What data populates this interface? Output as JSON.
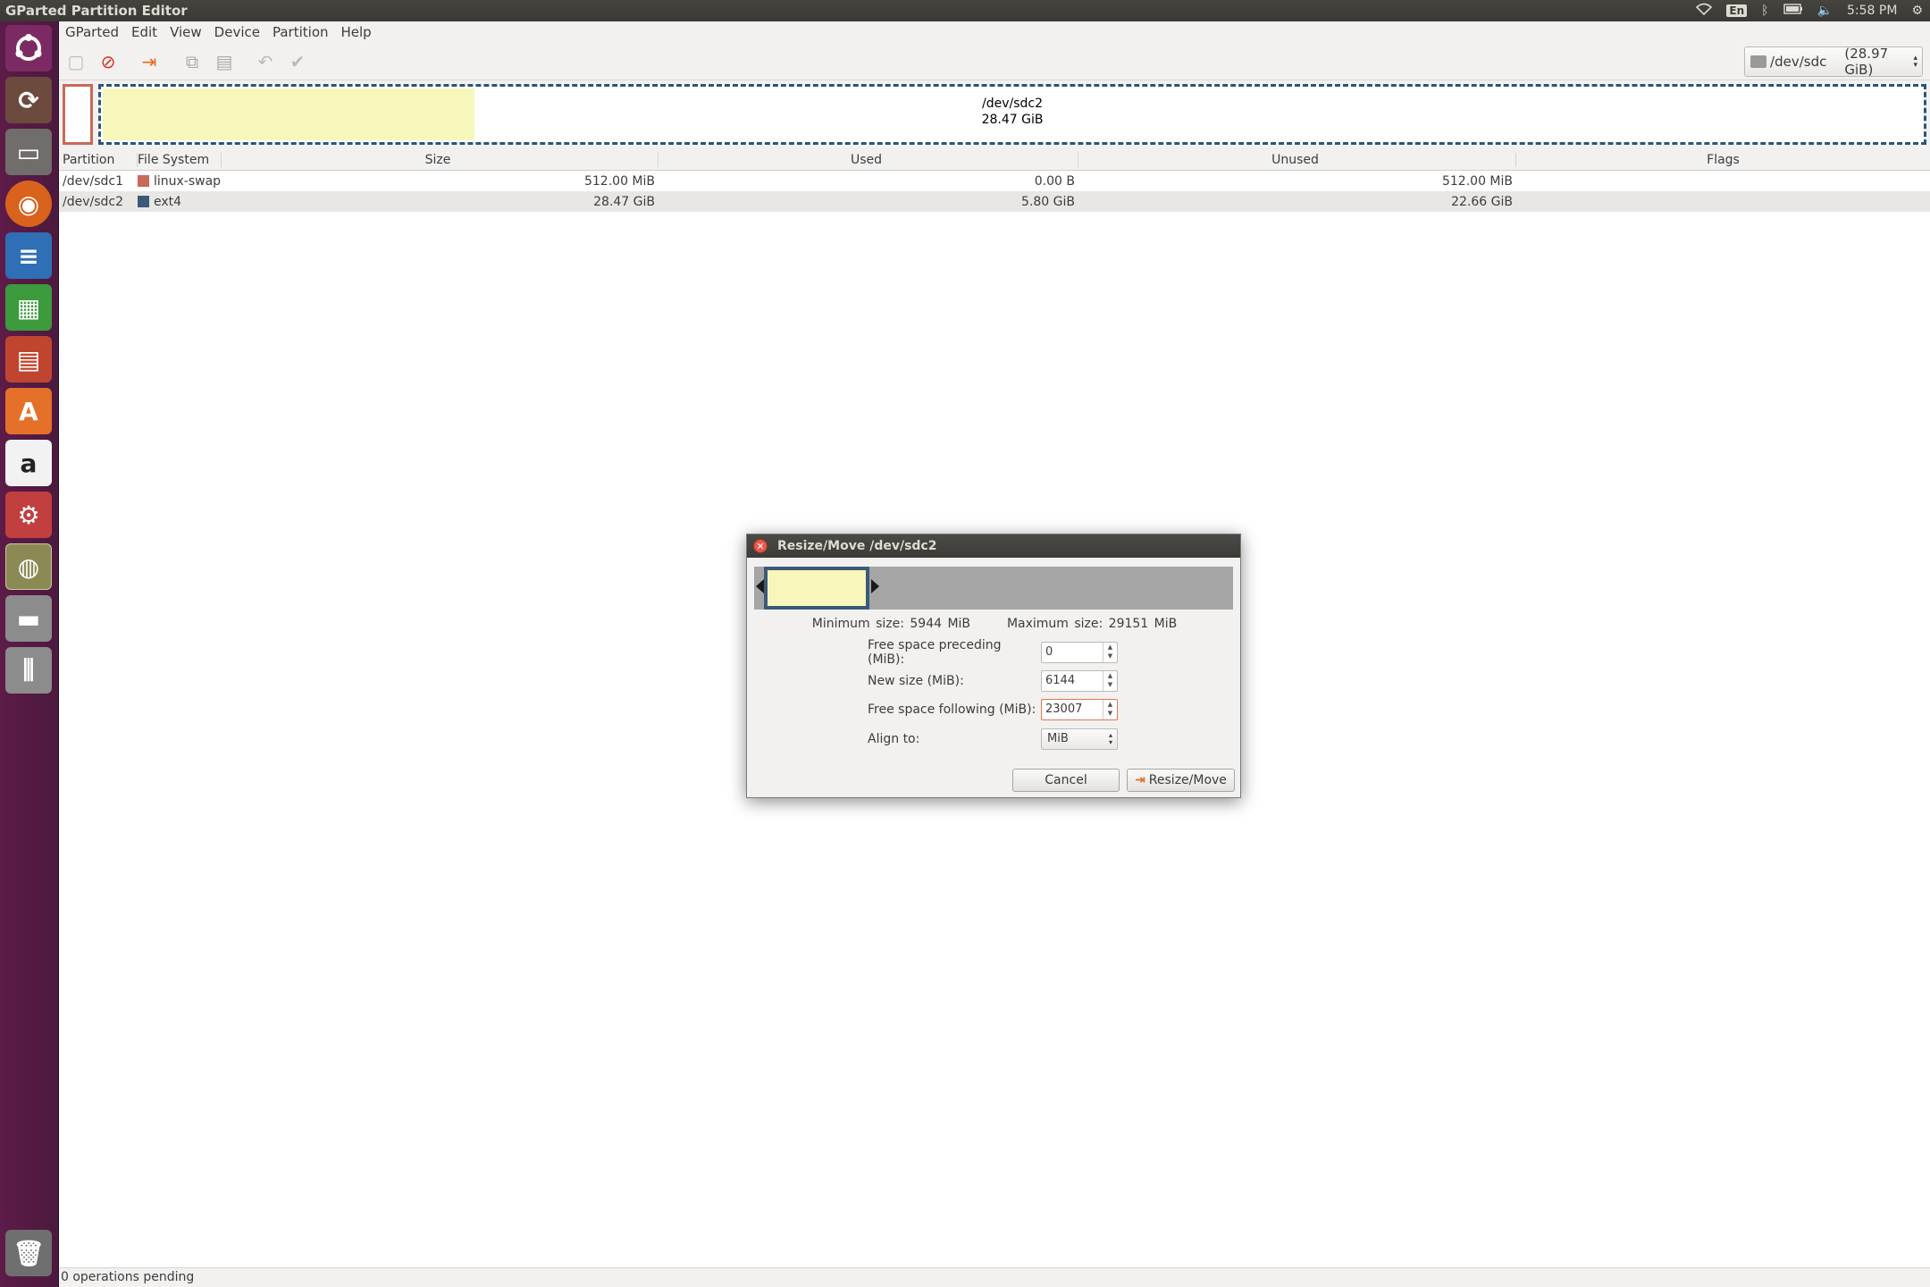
{
  "window": {
    "title": "GParted Partition Editor"
  },
  "menubar": [
    "GParted",
    "Edit",
    "View",
    "Device",
    "Partition",
    "Help"
  ],
  "indicators": {
    "keyboard": "En",
    "time": "5:58 PM"
  },
  "device_selector": {
    "device": "/dev/sdc",
    "size": "(28.97 GiB)"
  },
  "disk_map": {
    "partition_name": "/dev/sdc2",
    "partition_size": "28.47 GiB",
    "used_fraction": 0.204
  },
  "partition_table": {
    "headers": [
      "Partition",
      "File System",
      "Size",
      "Used",
      "Unused",
      "Flags"
    ],
    "rows": [
      {
        "partition": "/dev/sdc1",
        "fs": "linux-swap",
        "fs_color": "#c86959",
        "size": "512.00 MiB",
        "used": "0.00 B",
        "unused": "512.00 MiB",
        "flags": ""
      },
      {
        "partition": "/dev/sdc2",
        "fs": "ext4",
        "fs_color": "#3b5a7a",
        "size": "28.47 GiB",
        "used": "5.80 GiB",
        "unused": "22.66 GiB",
        "flags": ""
      }
    ]
  },
  "status": "0 operations pending",
  "dialog": {
    "title": "Resize/Move /dev/sdc2",
    "min_size": "Minimum size: 5944 MiB",
    "max_size": "Maximum size: 29151 MiB",
    "free_preceding_label": "Free space preceding (MiB):",
    "free_preceding_value": "0",
    "new_size_label": "New size (MiB):",
    "new_size_value": "6144",
    "free_following_label": "Free space following (MiB):",
    "free_following_value": "23007",
    "align_label": "Align to:",
    "align_value": "MiB",
    "cancel_label": "Cancel",
    "resize_label": "Resize/Move"
  }
}
